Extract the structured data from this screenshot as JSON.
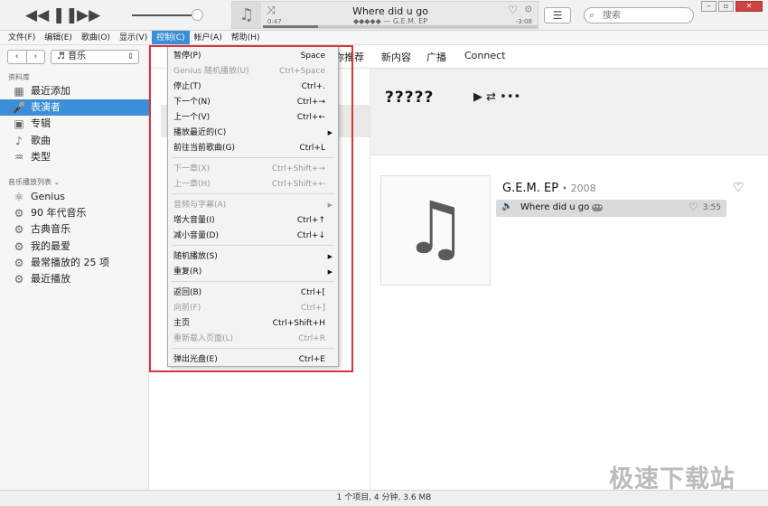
{
  "player": {
    "song_title": "Where did u go",
    "song_sub": "◆◆◆◆◆ — G.E.M. EP",
    "time_elapsed": "0:47",
    "time_remaining": "-3:08",
    "progress": 0.2,
    "search_placeholder": "搜索"
  },
  "menubar": [
    {
      "label": "文件(F)",
      "name": "menu-file"
    },
    {
      "label": "编辑(E)",
      "name": "menu-edit"
    },
    {
      "label": "歌曲(O)",
      "name": "menu-song"
    },
    {
      "label": "显示(V)",
      "name": "menu-view"
    },
    {
      "label": "控制(C)",
      "name": "menu-controls",
      "active": true
    },
    {
      "label": "帐户(A)",
      "name": "menu-account"
    },
    {
      "label": "帮助(H)",
      "name": "menu-help"
    }
  ],
  "sidebar": {
    "media_selector": "♬ 音乐",
    "library_header": "资料库",
    "library_items": [
      {
        "label": "最近添加",
        "icon": "grid-icon"
      },
      {
        "label": "表演者",
        "icon": "microphone-icon",
        "selected": true
      },
      {
        "label": "专辑",
        "icon": "album-icon"
      },
      {
        "label": "歌曲",
        "icon": "note-icon"
      },
      {
        "label": "类型",
        "icon": "genre-icon"
      }
    ],
    "playlists_header": "音乐播放列表 ⌄",
    "playlists": [
      {
        "label": "Genius",
        "icon": "genius-icon"
      },
      {
        "label": "90 年代音乐",
        "icon": "gear-icon"
      },
      {
        "label": "古典音乐",
        "icon": "gear-icon"
      },
      {
        "label": "我的最爱",
        "icon": "gear-icon"
      },
      {
        "label": "最常播放的 25 项",
        "icon": "gear-icon"
      },
      {
        "label": "最近播放",
        "icon": "gear-icon"
      }
    ]
  },
  "tabs": [
    "你推荐",
    "新内容",
    "广播",
    "Connect"
  ],
  "artist_header": {
    "artist": "?????",
    "controls": "▶ ⇄ •••"
  },
  "album": {
    "title": "G.E.M. EP",
    "year": " • 2008",
    "track_name": "Where did u go",
    "track_duration": "3:55"
  },
  "controls_menu": [
    {
      "label": "暂停(P)",
      "shortcut": "Space",
      "disabled": false
    },
    {
      "label": "Genius 随机播放(U)",
      "shortcut": "Ctrl+Space",
      "disabled": true
    },
    {
      "label": "停止(T)",
      "shortcut": "Ctrl+.",
      "disabled": false
    },
    {
      "label": "下一个(N)",
      "shortcut": "Ctrl+→",
      "disabled": false
    },
    {
      "label": "上一个(V)",
      "shortcut": "Ctrl+←",
      "disabled": false
    },
    {
      "label": "播放最近的(C)",
      "shortcut": "",
      "submenu": true,
      "disabled": false
    },
    {
      "label": "前往当前歌曲(G)",
      "shortcut": "Ctrl+L",
      "disabled": false
    },
    {
      "label": "下一章(X)",
      "shortcut": "Ctrl+Shift+→",
      "disabled": true
    },
    {
      "label": "上一章(H)",
      "shortcut": "Ctrl+Shift+←",
      "disabled": true
    },
    {
      "label": "音频与字幕(A)",
      "shortcut": "",
      "submenu": true,
      "disabled": true
    },
    {
      "label": "增大音量(I)",
      "shortcut": "Ctrl+↑",
      "disabled": false
    },
    {
      "label": "减小音量(D)",
      "shortcut": "Ctrl+↓",
      "disabled": false
    },
    {
      "label": "随机播放(S)",
      "shortcut": "",
      "submenu": true,
      "disabled": false
    },
    {
      "label": "重复(R)",
      "shortcut": "",
      "submenu": true,
      "disabled": false
    },
    {
      "label": "返回(B)",
      "shortcut": "Ctrl+[",
      "disabled": false
    },
    {
      "label": "向前(F)",
      "shortcut": "Ctrl+]",
      "disabled": true
    },
    {
      "label": "主页",
      "shortcut": "Ctrl+Shift+H",
      "disabled": false
    },
    {
      "label": "重新载入页面(L)",
      "shortcut": "Ctrl+R",
      "disabled": true
    },
    {
      "label": "弹出光盘(E)",
      "shortcut": "Ctrl+E",
      "disabled": false
    }
  ],
  "status": "1 个项目, 4 分钟, 3.6 MB",
  "watermark": "极速下载站",
  "colors": {
    "accent": "#3a8fd8",
    "highlight_box": "#d6363c"
  }
}
